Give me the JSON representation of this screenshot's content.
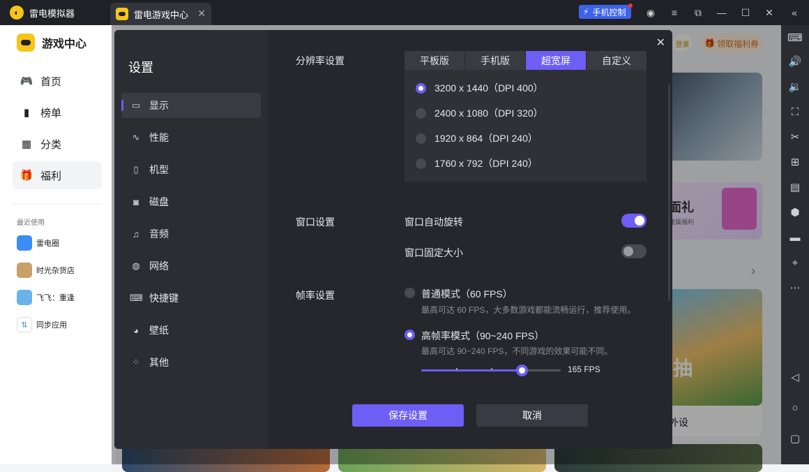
{
  "titlebar": {
    "app_name": "雷电模拟器",
    "tab_label": "雷电游戏中心",
    "phone_control": "手机控制"
  },
  "sidebar": {
    "brand": "游戏中心",
    "nav": [
      {
        "label": "首页",
        "icon": "gamepad-icon"
      },
      {
        "label": "榜单",
        "icon": "chart-icon"
      },
      {
        "label": "分类",
        "icon": "grid-icon"
      },
      {
        "label": "福利",
        "icon": "gift-icon"
      }
    ],
    "recent_label": "最近使用",
    "recent": [
      {
        "label": "雷电圈"
      },
      {
        "label": "时光杂货店"
      },
      {
        "label": "飞飞：重逢"
      },
      {
        "label": "同步应用"
      }
    ]
  },
  "background": {
    "login": "登录",
    "welfare_button": "领取福利券",
    "gift_title": "面礼",
    "gift_sub": "厘属福利",
    "game_caption": "外设",
    "game_banner": "抽"
  },
  "settings": {
    "title": "设置",
    "menu": [
      {
        "label": "显示",
        "icon": "monitor-icon"
      },
      {
        "label": "性能",
        "icon": "performance-icon"
      },
      {
        "label": "机型",
        "icon": "device-icon"
      },
      {
        "label": "磁盘",
        "icon": "disk-icon"
      },
      {
        "label": "音频",
        "icon": "audio-icon"
      },
      {
        "label": "网络",
        "icon": "globe-icon"
      },
      {
        "label": "快捷键",
        "icon": "keyboard-icon"
      },
      {
        "label": "壁纸",
        "icon": "palette-icon"
      },
      {
        "label": "其他",
        "icon": "more-icon"
      }
    ],
    "resolution": {
      "label": "分辨率设置",
      "tabs": [
        "平板版",
        "手机版",
        "超宽屏",
        "自定义"
      ],
      "active_tab": "超宽屏",
      "options": [
        "3200 x 1440（DPI 400）",
        "2400 x 1080（DPI 320）",
        "1920 x 864（DPI 240）",
        "1760 x 792（DPI 240）"
      ],
      "selected_index": 0
    },
    "window": {
      "label": "窗口设置",
      "auto_rotate": "窗口自动旋转",
      "auto_rotate_on": true,
      "fixed_size": "窗口固定大小",
      "fixed_size_on": false
    },
    "framerate": {
      "label": "帧率设置",
      "normal_title": "普通模式（60 FPS）",
      "normal_desc": "最高可达 60 FPS，大多数游戏都能流畅运行，推荐使用。",
      "high_title": "高帧率模式（90~240 FPS）",
      "high_desc": "最高可达 90~240 FPS，不同游戏的效果可能不同。",
      "fps_value": "165 FPS",
      "slider_fraction": 0.72
    },
    "save": "保存设置",
    "cancel": "取消"
  },
  "colors": {
    "accent": "#6d5ef5",
    "brand_yellow": "#f6c41a"
  }
}
